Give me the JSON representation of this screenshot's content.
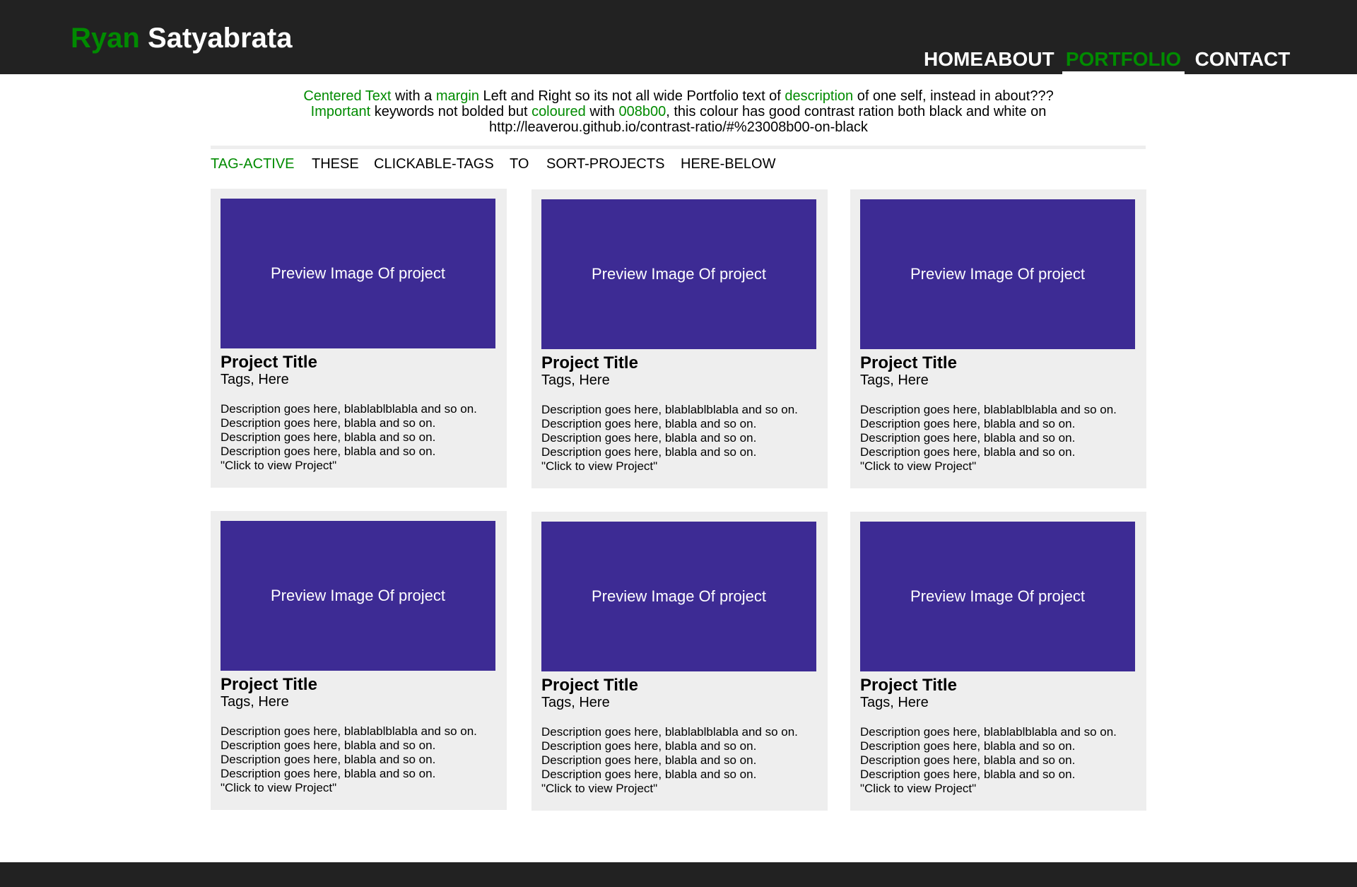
{
  "colors": {
    "accent": "#008b00",
    "header_bg": "#222222",
    "card_bg": "#eeeeee",
    "preview_bg": "#3d2b94"
  },
  "header": {
    "logo_first": "Ryan",
    "logo_last": "Satyabrata",
    "nav": [
      {
        "label": "HOME",
        "active": false
      },
      {
        "label": "ABOUT",
        "active": false
      },
      {
        "label": "PORTFOLIO",
        "active": true
      },
      {
        "label": "CONTACT",
        "active": false
      }
    ]
  },
  "intro": {
    "line1": [
      {
        "text": "Centered Text",
        "highlight": true
      },
      {
        "text": " with a ",
        "highlight": false
      },
      {
        "text": "margin",
        "highlight": true
      },
      {
        "text": " Left and Right so its not all wide Portfolio text of ",
        "highlight": false
      },
      {
        "text": "description",
        "highlight": true
      },
      {
        "text": " of one self, instead in about???",
        "highlight": false
      }
    ],
    "line2": [
      {
        "text": "Important",
        "highlight": true
      },
      {
        "text": " keywords not bolded but ",
        "highlight": false
      },
      {
        "text": "coloured",
        "highlight": true
      },
      {
        "text": " with ",
        "highlight": false
      },
      {
        "text": "008b00",
        "highlight": true
      },
      {
        "text": ", this colour has good contrast ration both black and white on",
        "highlight": false
      }
    ],
    "line3": "http://leaverou.github.io/contrast-ratio/#%23008b00-on-black"
  },
  "tags": [
    {
      "label": "TAG-ACTIVE",
      "active": true
    },
    {
      "label": "THESE",
      "active": false
    },
    {
      "label": "CLICKABLE-TAGS",
      "active": false
    },
    {
      "label": "TO",
      "active": false
    },
    {
      "label": "SORT-PROJECTS",
      "active": false
    },
    {
      "label": "HERE-BELOW",
      "active": false
    }
  ],
  "projects": [
    {
      "preview_label": "Preview Image Of project",
      "title": "Project Title",
      "tags": "Tags, Here",
      "description": [
        "Description goes here, blablablblabla and so on.",
        "Description goes here, blabla and so on.",
        "Description goes here, blabla and so on.",
        "Description goes here, blabla and so on.",
        "\"Click to view Project\""
      ]
    },
    {
      "preview_label": "Preview Image Of project",
      "title": "Project Title",
      "tags": "Tags, Here",
      "description": [
        "Description goes here, blablablblabla and so on.",
        "Description goes here, blabla and so on.",
        "Description goes here, blabla and so on.",
        "Description goes here, blabla and so on.",
        "\"Click to view Project\""
      ]
    },
    {
      "preview_label": "Preview Image Of project",
      "title": "Project Title",
      "tags": "Tags, Here",
      "description": [
        "Description goes here, blablablblabla and so on.",
        "Description goes here, blabla and so on.",
        "Description goes here, blabla and so on.",
        "Description goes here, blabla and so on.",
        "\"Click to view Project\""
      ]
    },
    {
      "preview_label": "Preview Image Of project",
      "title": "Project Title",
      "tags": "Tags, Here",
      "description": [
        "Description goes here, blablablblabla and so on.",
        "Description goes here, blabla and so on.",
        "Description goes here, blabla and so on.",
        "Description goes here, blabla and so on.",
        "\"Click to view Project\""
      ]
    },
    {
      "preview_label": "Preview Image Of project",
      "title": "Project Title",
      "tags": "Tags, Here",
      "description": [
        "Description goes here, blablablblabla and so on.",
        "Description goes here, blabla and so on.",
        "Description goes here, blabla and so on.",
        "Description goes here, blabla and so on.",
        "\"Click to view Project\""
      ]
    },
    {
      "preview_label": "Preview Image Of project",
      "title": "Project Title",
      "tags": "Tags, Here",
      "description": [
        "Description goes here, blablablblabla and so on.",
        "Description goes here, blabla and so on.",
        "Description goes here, blabla and so on.",
        "Description goes here, blabla and so on.",
        "\"Click to view Project\""
      ]
    }
  ]
}
